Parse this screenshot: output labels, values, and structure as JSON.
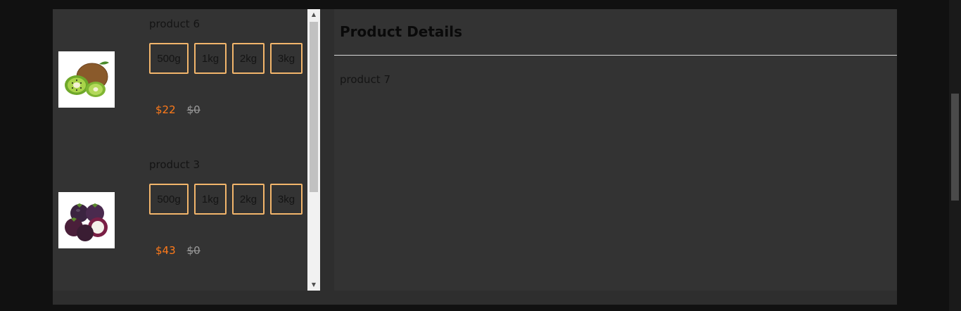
{
  "products": [
    {
      "name": "product 6",
      "image": "kiwi-fruit",
      "variants": [
        "500g",
        "1kg",
        "2kg",
        "3kg"
      ],
      "price": "$22",
      "old_price": "$0"
    },
    {
      "name": "product 3",
      "image": "mangosteen-fruit",
      "variants": [
        "500g",
        "1kg",
        "2kg",
        "3kg"
      ],
      "price": "$43",
      "old_price": "$0"
    }
  ],
  "details": {
    "title": "Product Details",
    "product_name": "product 7"
  },
  "colors": {
    "page_bg": "#111111",
    "panel_bg": "#333333",
    "variant_border": "#f2b56b",
    "price": "#ff7a1a",
    "old_price": "#9a9a9a"
  }
}
